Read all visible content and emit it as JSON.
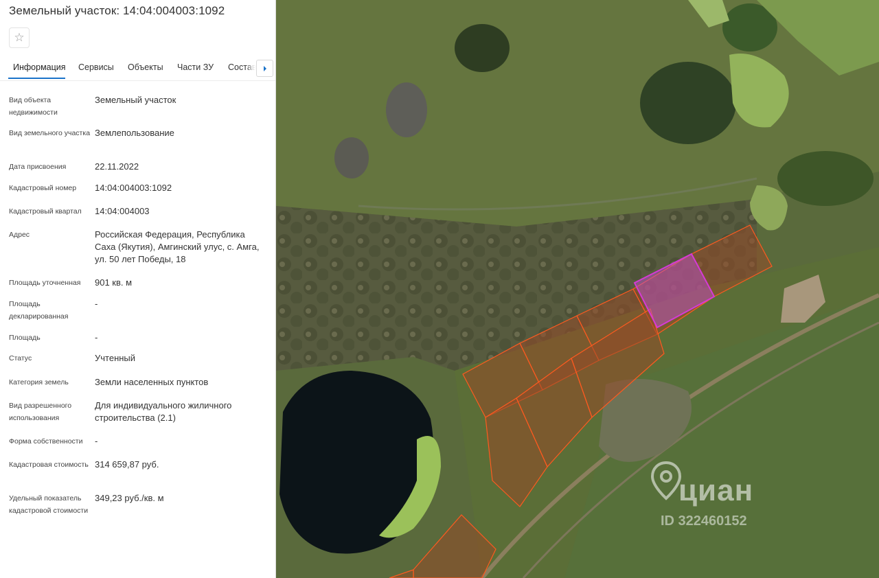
{
  "panel": {
    "title": "Земельный участок: 14:04:004003:1092",
    "favorite_icon": "star-outline-icon",
    "tabs": [
      {
        "label": "Информация",
        "active": true
      },
      {
        "label": "Сервисы",
        "active": false
      },
      {
        "label": "Объекты",
        "active": false
      },
      {
        "label": "Части ЗУ",
        "active": false
      },
      {
        "label": "Состав",
        "active": false
      }
    ],
    "tabs_next_icon": "caret-right-icon",
    "accent_color": "#1a73c9",
    "fields": [
      {
        "label": "Вид объекта недвижимости",
        "value": "Земельный участок"
      },
      {
        "label": "Вид земельного участка",
        "value": "Землепользование"
      },
      {
        "label": "Дата присвоения",
        "value": "22.11.2022"
      },
      {
        "label": "Кадастровый номер",
        "value": "14:04:004003:1092"
      },
      {
        "label": "Кадастровый квартал",
        "value": "14:04:004003"
      },
      {
        "label": "Адрес",
        "value": "Российская Федерация, Республика Саха (Якутия), Амгинский улус, с. Амга, ул. 50 лет Победы, 18"
      },
      {
        "label": "Площадь уточненная",
        "value": "901 кв. м"
      },
      {
        "label": "Площадь декларированная",
        "value": "-"
      },
      {
        "label": "Площадь",
        "value": "-"
      },
      {
        "label": "Статус",
        "value": "Учтенный"
      },
      {
        "label": "Категория земель",
        "value": "Земли населенных пунктов"
      },
      {
        "label": "Вид разрешенного использования",
        "value": "Для индивидуального жиличного строительства (2.1)"
      },
      {
        "label": "Форма собственности",
        "value": "-"
      },
      {
        "label": "Кадастровая стоимость",
        "value": "314 659,87 руб."
      },
      {
        "label": "Удельный показатель кадастровой стоимости",
        "value": "349,23 руб./кв. м"
      }
    ]
  },
  "map": {
    "parcel_outline_color": "#ff5a1f",
    "selected_parcel_color": "#d53ad6",
    "watermark": {
      "brand": "циан",
      "id_text": "ID 322460152",
      "icon": "location-pin-icon"
    }
  }
}
